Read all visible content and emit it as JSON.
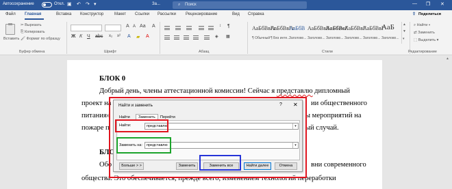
{
  "titlebar": {
    "autosave_label": "Автосохранение",
    "autosave_state": "Откл.",
    "doc_title": "За...",
    "search_placeholder": "Поиск",
    "minimize_icon": "minimize-icon",
    "restore_icon": "restore-icon",
    "close_icon": "close-icon"
  },
  "tabs": [
    "Файл",
    "Главная",
    "Вставка",
    "Конструктор",
    "Макет",
    "Ссылки",
    "Рассылки",
    "Рецензирование",
    "Вид",
    "Справка"
  ],
  "active_tab": "Главная",
  "share_label": "Поделиться",
  "ribbon": {
    "clipboard": {
      "paste": "Вставить",
      "cut": "Вырезать",
      "copy": "Копировать",
      "format_painter": "Формат по образцу",
      "group": "Буфер обмена"
    },
    "font_group": "Шрифт",
    "paragraph_group": "Абзац",
    "styles_group": "Стили",
    "editing": {
      "find": "Найти",
      "replace": "Заменить",
      "select": "Выделить",
      "group": "Редактирование"
    },
    "styles": [
      {
        "sample": "АаБбВвГг",
        "name": "¶ Обычный"
      },
      {
        "sample": "АаБбВвГг",
        "name": "¶ Без инте..."
      },
      {
        "sample": "АаБбВ",
        "name": "Заголово..."
      },
      {
        "sample": "АаБбВвГ",
        "name": "Заголово..."
      },
      {
        "sample": "АаБбВвГ",
        "name": "Заголово..."
      },
      {
        "sample": "АаБбВвГ",
        "name": "Заголово..."
      },
      {
        "sample": "АаБбВвГ",
        "name": "Заголово..."
      },
      {
        "sample": "АаБ",
        "name": "Заголово..."
      }
    ]
  },
  "document": {
    "heading1": "БЛОК 0",
    "line1_a": "Добрый день, члены аттестационной комиссии! Сейчас я ",
    "line1_b": "представлю",
    "line1_c": " дипломный",
    "line2_a": "проект на",
    "line2_b": "ии общественного",
    "line3_a": "питания»",
    "line3_b": "ы мероприятий на",
    "line4_a": "пожаре п",
    "line4_b": "ый случай.",
    "heading2": "БЛО",
    "line5_a": "Обо",
    "line5_b": "вни современного",
    "line6": "общества. Это обеспечивается, прежде всего, изменением технологий переработки"
  },
  "dialog": {
    "title": "Найти и заменить",
    "help": "?",
    "close": "✕",
    "tabs": [
      "Найти",
      "Заменить",
      "Перейти"
    ],
    "active_tab": "Заменить",
    "find_label": "Найти:",
    "find_value": "представлю",
    "replace_label": "Заменить на:",
    "replace_value": "представлю",
    "buttons": {
      "more": "Больше > >",
      "replace": "Заменить",
      "replace_all": "Заменить все",
      "find_next": "Найти далее",
      "cancel": "Отмена"
    }
  },
  "colors": {
    "titlebar": "#2b579a",
    "annotation_red": "#e0141e",
    "annotation_green": "#1aa32a",
    "annotation_blue": "#2634d8"
  }
}
